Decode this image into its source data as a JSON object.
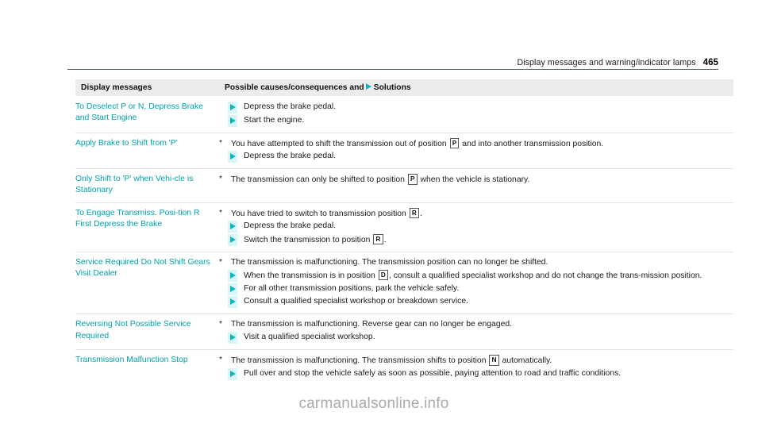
{
  "header": {
    "title": "Display messages and warning/indicator lamps",
    "page_number": "465",
    "rule_color": "#5d6a6d"
  },
  "colors": {
    "message_text": "#00a3ac",
    "arrow": "#12b5bd",
    "arrow_block": "#d6f6f8",
    "header_bg": "#ececec",
    "rule": "#e3e3e3",
    "watermark": "#aaaaaa"
  },
  "table": {
    "columns": {
      "messages": "Display messages",
      "causes_prefix": "Possible causes/consequences and",
      "causes_suffix": "Solutions"
    },
    "rows": [
      {
        "message": "To Deselect P or N, Depress Brake and Start Engine",
        "causes": [],
        "solutions": [
          {
            "parts": [
              {
                "t": "text",
                "v": "Depress the brake pedal."
              }
            ]
          },
          {
            "parts": [
              {
                "t": "text",
                "v": "Start the engine."
              }
            ]
          }
        ]
      },
      {
        "message": "Apply Brake to Shift from 'P'",
        "causes": [
          {
            "parts": [
              {
                "t": "text",
                "v": "You have attempted to shift the transmission out of position "
              },
              {
                "t": "gear",
                "v": "P"
              },
              {
                "t": "text",
                "v": " and into another transmission position."
              }
            ]
          }
        ],
        "solutions": [
          {
            "parts": [
              {
                "t": "text",
                "v": "Depress the brake pedal."
              }
            ]
          }
        ]
      },
      {
        "message": "Only Shift to 'P' when Vehi-cle is Stationary",
        "causes": [
          {
            "parts": [
              {
                "t": "text",
                "v": "The transmission can only be shifted to position "
              },
              {
                "t": "gear",
                "v": "P"
              },
              {
                "t": "text",
                "v": " when the vehicle is stationary."
              }
            ]
          }
        ],
        "solutions": []
      },
      {
        "message": "To Engage Transmiss. Posi-tion R First Depress the Brake",
        "causes": [
          {
            "parts": [
              {
                "t": "text",
                "v": "You have tried to switch to transmission position "
              },
              {
                "t": "gear",
                "v": "R"
              },
              {
                "t": "text",
                "v": "."
              }
            ]
          }
        ],
        "solutions": [
          {
            "parts": [
              {
                "t": "text",
                "v": "Depress the brake pedal."
              }
            ]
          },
          {
            "parts": [
              {
                "t": "text",
                "v": "Switch the transmission to position "
              },
              {
                "t": "gear",
                "v": "R"
              },
              {
                "t": "text",
                "v": "."
              }
            ]
          }
        ]
      },
      {
        "message": "Service Required Do Not Shift Gears Visit Dealer",
        "causes": [
          {
            "parts": [
              {
                "t": "text",
                "v": "The transmission is malfunctioning. The transmission position can no longer be shifted."
              }
            ]
          }
        ],
        "solutions": [
          {
            "parts": [
              {
                "t": "text",
                "v": "When the transmission is in position "
              },
              {
                "t": "gear",
                "v": "D"
              },
              {
                "t": "text",
                "v": ", consult a qualified specialist workshop and do not change the trans-mission position."
              }
            ]
          },
          {
            "parts": [
              {
                "t": "text",
                "v": "For all other transmission positions, park the vehicle safely."
              }
            ]
          },
          {
            "parts": [
              {
                "t": "text",
                "v": "Consult a qualified specialist workshop or breakdown service."
              }
            ]
          }
        ]
      },
      {
        "message": "Reversing Not Possible Service Required",
        "causes": [
          {
            "parts": [
              {
                "t": "text",
                "v": "The transmission is malfunctioning. Reverse gear can no longer be engaged."
              }
            ]
          }
        ],
        "solutions": [
          {
            "parts": [
              {
                "t": "text",
                "v": "Visit a qualified specialist workshop."
              }
            ]
          }
        ]
      },
      {
        "message": "Transmission Malfunction Stop",
        "causes": [
          {
            "parts": [
              {
                "t": "text",
                "v": "The transmission is malfunctioning. The transmission shifts to position "
              },
              {
                "t": "gear",
                "v": "N"
              },
              {
                "t": "text",
                "v": " automatically."
              }
            ]
          }
        ],
        "solutions": [
          {
            "parts": [
              {
                "t": "text",
                "v": "Pull over and stop the vehicle safely as soon as possible, paying attention to road and traffic conditions."
              }
            ]
          }
        ]
      }
    ]
  },
  "watermark": {
    "text": "carmanualsonline.info"
  }
}
